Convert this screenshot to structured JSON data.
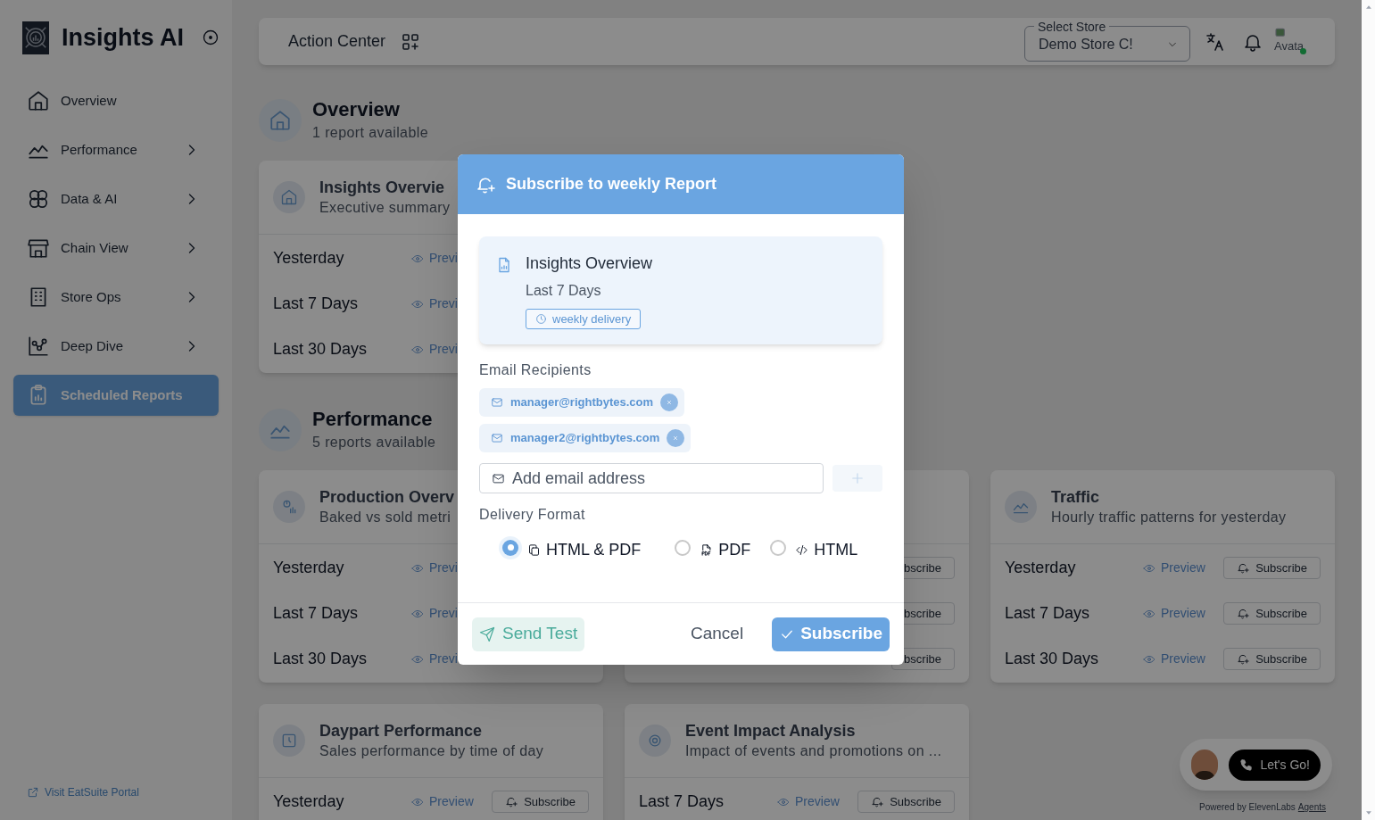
{
  "sidebar": {
    "brand": "Insights AI",
    "nav": [
      {
        "label": "Overview",
        "has_submenu": false,
        "selected": false
      },
      {
        "label": "Performance",
        "has_submenu": true,
        "selected": false
      },
      {
        "label": "Data & AI",
        "has_submenu": true,
        "selected": false
      },
      {
        "label": "Chain View",
        "has_submenu": true,
        "selected": false
      },
      {
        "label": "Store Ops",
        "has_submenu": true,
        "selected": false
      },
      {
        "label": "Deep Dive",
        "has_submenu": true,
        "selected": false
      },
      {
        "label": "Scheduled Reports",
        "has_submenu": false,
        "selected": true
      }
    ],
    "footer_link": "Visit EatSuite Portal"
  },
  "top_bar": {
    "title": "Action Center",
    "store_select": {
      "label": "Select Store",
      "value": "Demo Store C!"
    },
    "avatar_alt": "Avata",
    "avatar_online": true
  },
  "sections": [
    {
      "title": "Overview",
      "subtitle": "1 report available",
      "cards": [
        {
          "title": "Insights Overvie",
          "subtitle": "Executive summary",
          "rows": [
            {
              "period": "Yesterday",
              "preview": "Previ"
            },
            {
              "period": "Last 7 Days",
              "preview": "Previ"
            },
            {
              "period": "Last 30 Days",
              "preview": "Previ"
            }
          ]
        }
      ]
    },
    {
      "title": "Performance",
      "subtitle": "5 reports available",
      "cards": [
        {
          "title": "Production Overv",
          "subtitle": "Baked vs sold metri",
          "rows": [
            {
              "period": "Yesterday",
              "preview": "Previ"
            },
            {
              "period": "Last 7 Days",
              "preview": "Previ"
            },
            {
              "period": "Last 30 Days",
              "preview": "Previ"
            }
          ]
        },
        {
          "rows": [
            {
              "subscribe": "bscribe"
            },
            {
              "subscribe": "bscribe"
            },
            {
              "subscribe": "bscribe"
            }
          ]
        },
        {
          "title": "Traffic",
          "subtitle": "Hourly traffic patterns for yesterday",
          "rows": [
            {
              "period": "Yesterday",
              "preview": "Preview",
              "subscribe": "Subscribe"
            },
            {
              "period": "Last 7 Days",
              "preview": "Preview",
              "subscribe": "Subscribe"
            },
            {
              "period": "Last 30 Days",
              "preview": "Preview",
              "subscribe": "Subscribe"
            }
          ]
        },
        {
          "title": "Daypart Performance",
          "subtitle": "Sales performance by time of day",
          "rows": [
            {
              "period": "Yesterday",
              "preview": "Preview",
              "subscribe": "Subscribe"
            }
          ]
        },
        {
          "title": "Event Impact Analysis",
          "subtitle": "Impact of events and promotions on ...",
          "rows": [
            {
              "period": "Last 7 Days",
              "preview": "Preview",
              "subscribe": "Subscribe"
            }
          ]
        }
      ]
    }
  ],
  "chat_widget": {
    "button": "Let's Go!",
    "powered_by": "Powered by ElevenLabs",
    "powered_link": "Agents"
  },
  "modal": {
    "title": "Subscribe to weekly Report",
    "report": {
      "title": "Insights Overview",
      "period": "Last 7 Days",
      "badge": "weekly delivery"
    },
    "recipients_label": "Email Recipients",
    "recipients": [
      "manager@rightbytes.com",
      "manager2@rightbytes.com"
    ],
    "email_placeholder": "Add email address",
    "add_disabled": true,
    "format_label": "Delivery Format",
    "formats": [
      {
        "label": "HTML & PDF",
        "selected": true
      },
      {
        "label": "PDF",
        "selected": false
      },
      {
        "label": "HTML",
        "selected": false
      }
    ],
    "buttons": {
      "send_test": "Send Test",
      "cancel": "Cancel",
      "subscribe": "Subscribe"
    }
  }
}
